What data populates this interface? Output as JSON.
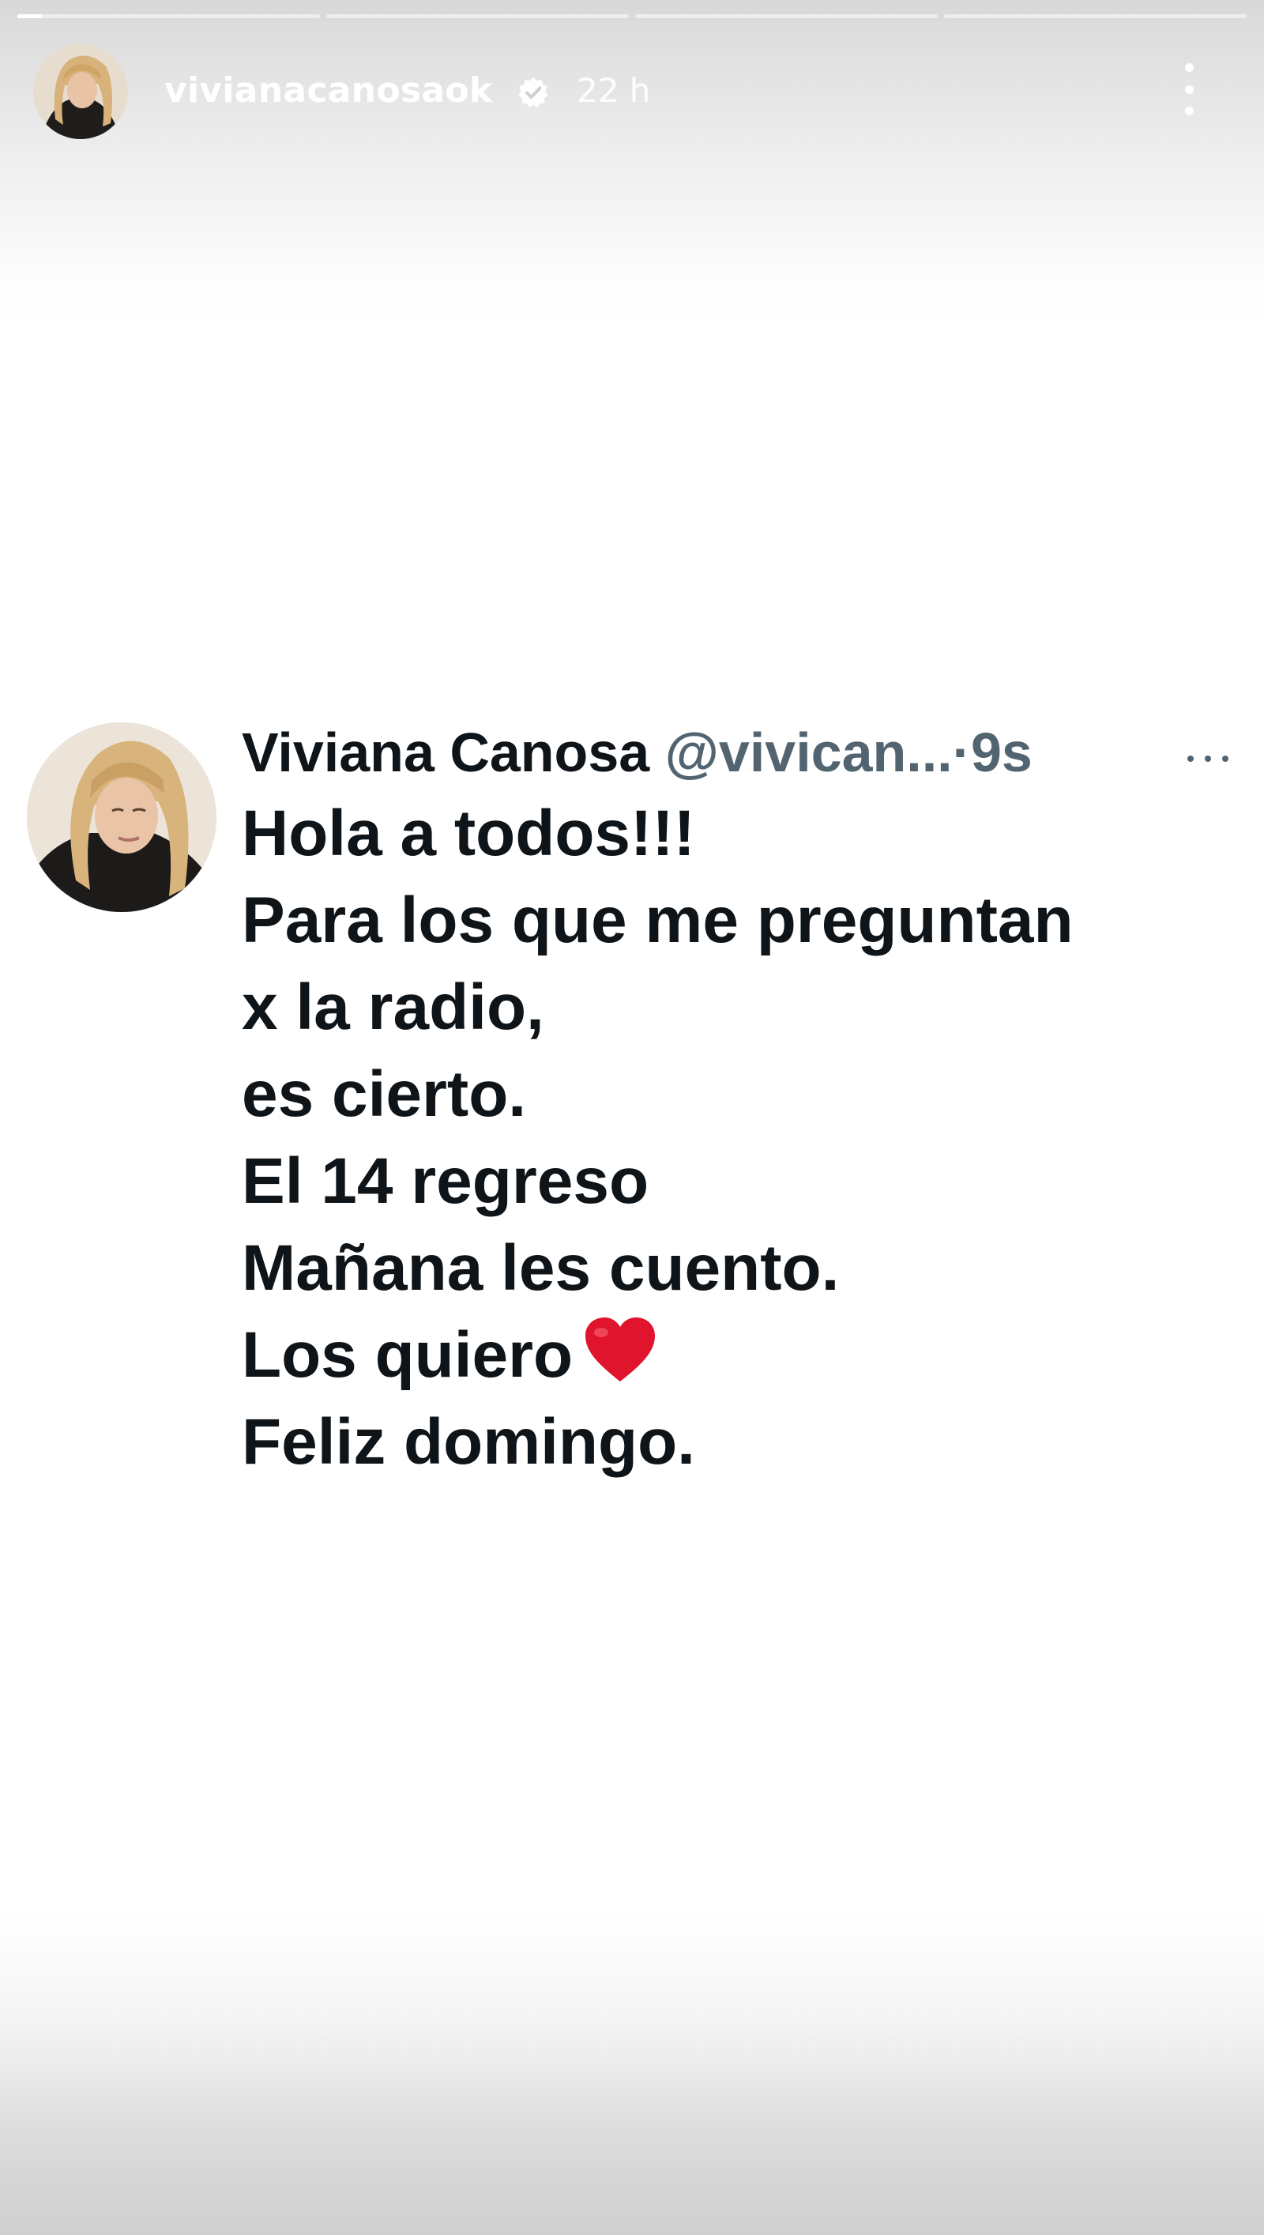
{
  "story": {
    "segments": [
      {
        "progress": 0.08
      },
      {
        "progress": 0
      },
      {
        "progress": 0
      },
      {
        "progress": 0
      }
    ],
    "username": "vivianacanosaok",
    "time": "22 h",
    "verified": true,
    "verified_icon": "verified-badge-icon",
    "menu_icon": "more-vertical-icon"
  },
  "tweet": {
    "name": "Viviana Canosa",
    "handle": "@vivican...",
    "separator": "·",
    "ago": "9s",
    "menu_icon": "more-horizontal-icon",
    "lines": [
      "Hola a todos!!!",
      "Para los que me preguntan",
      "x la radio,",
      "es cierto.",
      "El 14 regreso",
      "Mañana les cuento.",
      "Los quiero",
      "Feliz domingo."
    ],
    "heart_icon": "red-heart-emoji-icon"
  },
  "colors": {
    "heart": "#e0142c",
    "text_primary": "#0f1419",
    "text_secondary": "#536471",
    "header_text": "#ffffff"
  }
}
